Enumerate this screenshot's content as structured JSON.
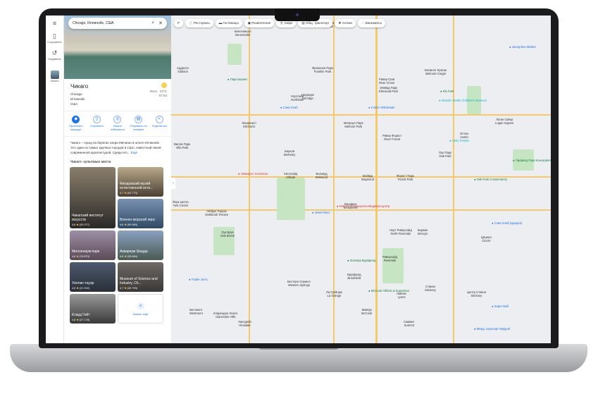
{
  "search": {
    "value": "Chicago, Иллинойс, США"
  },
  "rail": {
    "saved": "Сохранено",
    "recent": "Недавние",
    "chicago": "Чикаго"
  },
  "place": {
    "title": "Чикаго",
    "line1": "Chicago",
    "line2": "Иллинойс",
    "line3": "США",
    "weather": "Ясно · 23°C",
    "time": "07:54"
  },
  "actions": [
    {
      "label": "Проложить маршрут",
      "icon": "◆"
    },
    {
      "label": "Сохранить",
      "icon": "▯"
    },
    {
      "label": "Искать поблизости",
      "icon": "◎"
    },
    {
      "label": "Отправить на телефон",
      "icon": "▤"
    },
    {
      "label": "Поделиться",
      "icon": "<"
    }
  ],
  "description": {
    "text": "Чикаго – город на берегах озера Мичиган в штате Иллинойс. Это один из самых крупных городов в США, известный своей современной архитектурой. Среди его... ",
    "more": "Ещё"
  },
  "iconic": {
    "title": "Чикаго: культовые места",
    "items": [
      {
        "name": "Чикагский институт искусств",
        "rating": "4,8",
        "count": "(30 077)"
      },
      {
        "name": "Филдовский музей естественной исто...",
        "rating": "4,7",
        "count": "(22 773)"
      },
      {
        "name": "Военно-морской пирс",
        "rating": "4,6",
        "count": "(59 984)"
      },
      {
        "name": "Миллениум-парк",
        "rating": "4,8",
        "count": "(78 870)"
      },
      {
        "name": "Аквариум Шедда",
        "rating": "4,6",
        "count": "(28 664)"
      },
      {
        "name": "Уиллис-тауэр",
        "rating": "4,5",
        "count": "(21 092)"
      },
      {
        "name": "Museum of Science and Industry, Ch...",
        "rating": "4,7",
        "count": "(26 793)"
      },
      {
        "name": "Клауд Гейт",
        "rating": "4,8",
        "count": "(27 178)"
      }
    ],
    "search_more": "Искать ещё"
  },
  "chips": [
    "Рестораны",
    "Гостиницы",
    "Развлечения",
    "Кафе",
    "Общ. транспорт",
    "Аптеки",
    "Банкоматы"
  ],
  "layers": "Р",
  "map_labels": [
    "Аддисон\nAddison",
    "Бенсенвилл\nBensenville",
    "Франклин Парк\nFranklin Park",
    "Норридж\nNorridge",
    "Ривер Гров\nRiver Grove",
    "Элмвуд Парк\nElmwood Park",
    "Нортлейк\nNorthlake",
    "Эльмхерст\nElmhurst",
    "Мелроуз Парк\nMelrose Park",
    "Вилла Парк\nVilla Park",
    "Беркли\nBerkeley",
    "Ривер Форест\nRiver Forest",
    "Оук Парк\nOak Park",
    "Хиллсайд\nHillside",
    "Бельвуд\nBellwood",
    "Мэйвуд\nMaywood",
    "Форест Парк\nForest Park",
    "Бродвью\nBroadview",
    "Йорк Центр\nYork Center",
    "Окбрук Террас\nOakbrook Terrace",
    "Оук Брук\nOak Brook",
    "Норт Риверсайд\nNorth Riverside",
    "Бервин\nBerwyn",
    "Цицеро\nCicero",
    "Риверсайд\nRiverside",
    "Брукфилд\nBrookfield",
    "Вестерн Спрингс\nWestern Springs",
    "Ла Грейндж\nLa Grange",
    "Лайонс\nLyons",
    "Стикни\nStickney",
    "МакКук\nMcCook",
    "Саммит\nSummit",
    "Вестмонт\nWestmont",
    "Хинсдейл\nHinsdale",
    "Кларендон Хиллс\nClarendon Hills",
    "Белмонт Крагин\nBelmont Cragin",
    "Логан Сквер\nLogan Square",
    "Остин\nAustin",
    "Центр Стикни\nStickney",
    "Шиллер Парк\nSchiller Park"
  ],
  "map_pois": [
    "Joong Boo Market",
    "Ris Park",
    "Wonder Works Children's Museum",
    "Unity Temple",
    "Гарфилд Парк Консерватория",
    "Oak Park Conservatory",
    "Парк Беринс",
    "Сэмс Клаб",
    "Costco Wholesale",
    "Элмхерст Хоспитал",
    "Jewel-Osco",
    "Лойола Юниверсити Медикал Центр",
    "Зоопарк Брукфилд",
    "Trader Joe's",
    "McCook Athletic & Exposition",
    "Межд. аэропорт Мидуэй",
    "Сэмс Клаб (Цицеро)",
    "Super Mall"
  ]
}
